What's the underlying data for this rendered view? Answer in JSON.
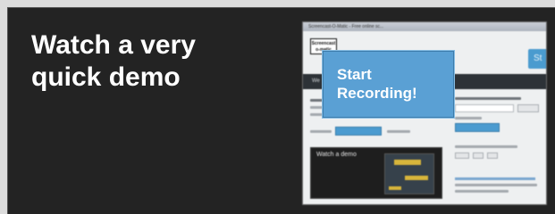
{
  "headline": {
    "line1": "Watch a very",
    "line2": "quick demo"
  },
  "thumbnail": {
    "window_title": "Screencast-O-Matic - Free online sc...",
    "logo_text_1": "Screencast",
    "logo_text_2": "o-matic",
    "corner_button": "St",
    "nav_text": "We",
    "video_title": "Watch a demo"
  },
  "overlay_button": {
    "line1": "Start",
    "line2": "Recording!"
  }
}
